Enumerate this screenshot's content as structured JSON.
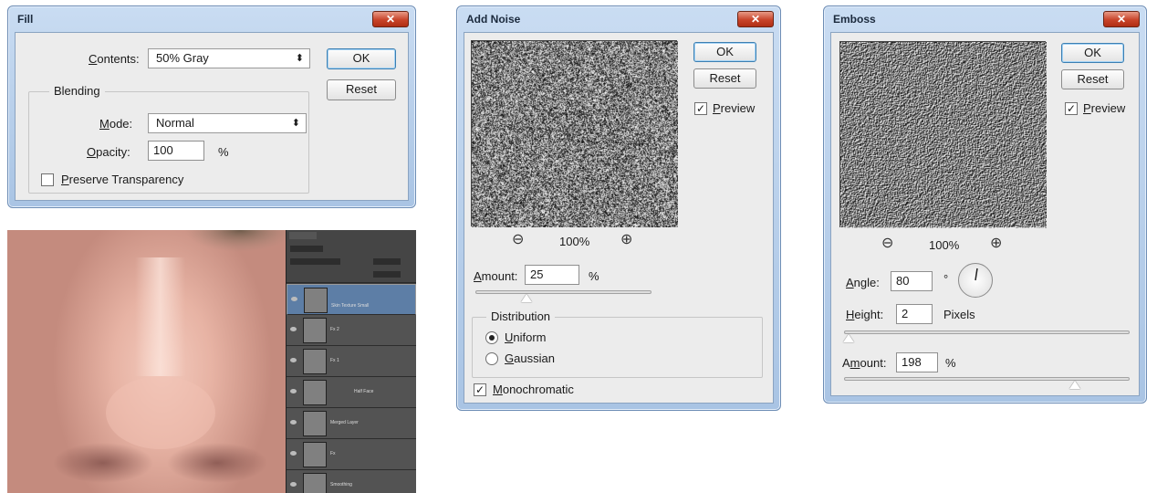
{
  "fill": {
    "title": "Fill",
    "contents_label": "Contents:",
    "contents_value": "50% Gray",
    "ok": "OK",
    "reset": "Reset",
    "blending_legend": "Blending",
    "mode_label": "Mode:",
    "mode_value": "Normal",
    "opacity_label": "Opacity:",
    "opacity_value": "100",
    "opacity_unit": "%",
    "preserve_label": "Preserve Transparency",
    "preserve_checked": false
  },
  "add_noise": {
    "title": "Add Noise",
    "ok": "OK",
    "reset": "Reset",
    "preview_label": "Preview",
    "preview_checked": true,
    "zoom": "100%",
    "amount_label": "Amount:",
    "amount_value": "25",
    "amount_unit": "%",
    "distribution_legend": "Distribution",
    "uniform_label": "Uniform",
    "gaussian_label": "Gaussian",
    "selected_distribution": "Uniform",
    "monochromatic_label": "Monochromatic",
    "monochromatic_checked": true
  },
  "emboss": {
    "title": "Emboss",
    "ok": "OK",
    "reset": "Reset",
    "preview_label": "Preview",
    "preview_checked": true,
    "zoom": "100%",
    "angle_label": "Angle:",
    "angle_value": "80",
    "angle_unit": "°",
    "height_label": "Height:",
    "height_value": "2",
    "height_unit": "Pixels",
    "amount_label": "Amount:",
    "amount_value": "198",
    "amount_unit": "%"
  },
  "layers_panel": {
    "layers": [
      {
        "name": "Skin Texture Small",
        "selected": true
      },
      {
        "name": "Fx 2",
        "selected": false
      },
      {
        "name": "Fx 1",
        "selected": false
      },
      {
        "name": "Half Face",
        "selected": false
      },
      {
        "name": "Merged Layer",
        "selected": false
      },
      {
        "name": "Fx",
        "selected": false
      },
      {
        "name": "Smoothing",
        "selected": false
      }
    ]
  },
  "colors": {
    "title_bar": "#b6cde9",
    "dialog_body": "#ececec",
    "close_button": "#c8442a",
    "selected_layer": "#5d7ea6"
  }
}
